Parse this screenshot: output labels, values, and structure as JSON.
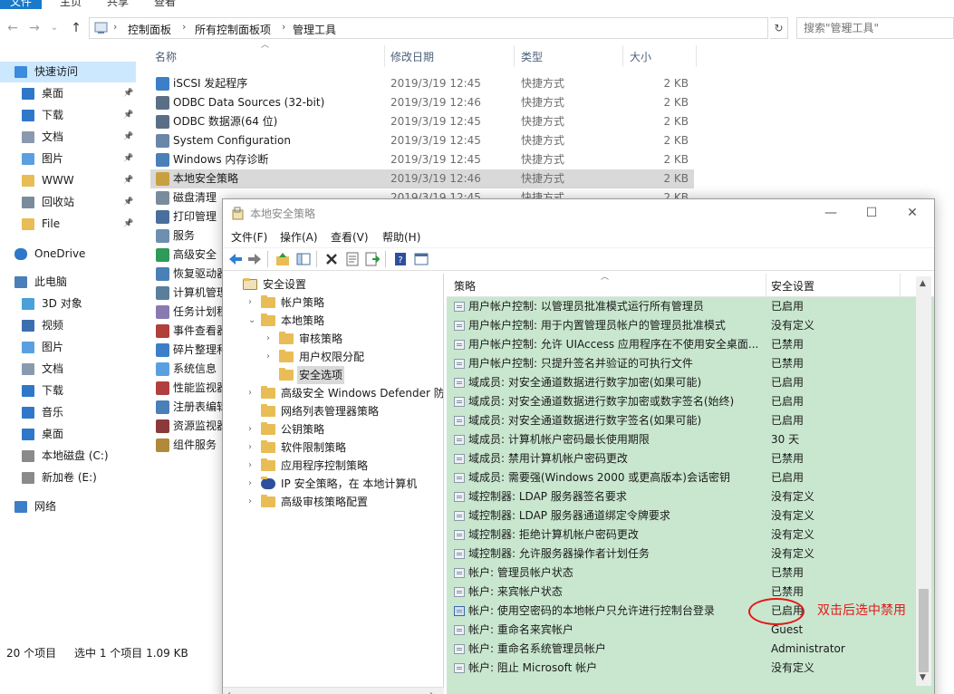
{
  "explorer": {
    "ribbon_tabs": [
      "文件",
      "主页",
      "共享",
      "查看"
    ],
    "breadcrumb": [
      "控制面板",
      "所有控制面板项",
      "管理工具"
    ],
    "search_placeholder": "搜索\"管理工具\"",
    "columns": {
      "name": "名称",
      "date": "修改日期",
      "type": "类型",
      "size": "大小"
    },
    "nav": [
      {
        "label": "快速访问",
        "icon": "star-icon",
        "pinned": false
      },
      {
        "label": "桌面",
        "icon": "desktop-icon",
        "pinned": true
      },
      {
        "label": "下载",
        "icon": "download-icon",
        "pinned": true
      },
      {
        "label": "文档",
        "icon": "document-icon",
        "pinned": true
      },
      {
        "label": "图片",
        "icon": "pictures-icon",
        "pinned": true
      },
      {
        "label": "WWW",
        "icon": "folder-icon",
        "pinned": true
      },
      {
        "label": "回收站",
        "icon": "recycle-bin-icon",
        "pinned": true
      },
      {
        "label": "File",
        "icon": "folder-icon",
        "pinned": true
      },
      {
        "label": "OneDrive",
        "icon": "cloud-icon",
        "pinned": false
      },
      {
        "label": "此电脑",
        "icon": "computer-icon",
        "pinned": false
      },
      {
        "label": "3D 对象",
        "icon": "3d-objects-icon",
        "pinned": false
      },
      {
        "label": "视频",
        "icon": "video-icon",
        "pinned": false
      },
      {
        "label": "图片",
        "icon": "pictures-icon",
        "pinned": false
      },
      {
        "label": "文档",
        "icon": "document-icon",
        "pinned": false
      },
      {
        "label": "下载",
        "icon": "download-icon",
        "pinned": false
      },
      {
        "label": "音乐",
        "icon": "music-icon",
        "pinned": false
      },
      {
        "label": "桌面",
        "icon": "desktop-icon",
        "pinned": false
      },
      {
        "label": "本地磁盘 (C:)",
        "icon": "drive-icon",
        "pinned": false
      },
      {
        "label": "新加卷 (E:)",
        "icon": "drive-icon",
        "pinned": false
      },
      {
        "label": "网络",
        "icon": "network-icon",
        "pinned": false
      }
    ],
    "files": [
      {
        "name": "iSCSI 发起程序",
        "date": "2019/3/19 12:45",
        "type": "快捷方式",
        "size": "2 KB"
      },
      {
        "name": "ODBC Data Sources (32-bit)",
        "date": "2019/3/19 12:46",
        "type": "快捷方式",
        "size": "2 KB"
      },
      {
        "name": "ODBC 数据源(64 位)",
        "date": "2019/3/19 12:45",
        "type": "快捷方式",
        "size": "2 KB"
      },
      {
        "name": "System Configuration",
        "date": "2019/3/19 12:45",
        "type": "快捷方式",
        "size": "2 KB"
      },
      {
        "name": "Windows 内存诊断",
        "date": "2019/3/19 12:45",
        "type": "快捷方式",
        "size": "2 KB"
      },
      {
        "name": "本地安全策略",
        "date": "2019/3/19 12:46",
        "type": "快捷方式",
        "size": "2 KB"
      },
      {
        "name": "磁盘清理",
        "date": "2019/3/19 12:45",
        "type": "快捷方式",
        "size": "2 KB"
      },
      {
        "name": "打印管理",
        "date": "",
        "type": "",
        "size": ""
      },
      {
        "name": "服务",
        "date": "",
        "type": "",
        "size": ""
      },
      {
        "name": "高级安全",
        "date": "",
        "type": "",
        "size": ""
      },
      {
        "name": "恢复驱动器",
        "date": "",
        "type": "",
        "size": ""
      },
      {
        "name": "计算机管理",
        "date": "",
        "type": "",
        "size": ""
      },
      {
        "name": "任务计划程序",
        "date": "",
        "type": "",
        "size": ""
      },
      {
        "name": "事件查看器",
        "date": "",
        "type": "",
        "size": ""
      },
      {
        "name": "碎片整理和",
        "date": "",
        "type": "",
        "size": ""
      },
      {
        "name": "系统信息",
        "date": "",
        "type": "",
        "size": ""
      },
      {
        "name": "性能监视器",
        "date": "",
        "type": "",
        "size": ""
      },
      {
        "name": "注册表编辑器",
        "date": "",
        "type": "",
        "size": ""
      },
      {
        "name": "资源监视器",
        "date": "",
        "type": "",
        "size": ""
      },
      {
        "name": "组件服务",
        "date": "",
        "type": "",
        "size": ""
      }
    ],
    "status": {
      "count": "20 个项目",
      "selected": "选中 1 个项目  1.09 KB"
    }
  },
  "lsp": {
    "title": "本地安全策略",
    "menu": [
      "文件(F)",
      "操作(A)",
      "查看(V)",
      "帮助(H)"
    ],
    "tree": [
      {
        "label": "安全设置",
        "level": 0,
        "expand": ""
      },
      {
        "label": "帐户策略",
        "level": 1,
        "expand": "›"
      },
      {
        "label": "本地策略",
        "level": 1,
        "expand": "⌄"
      },
      {
        "label": "审核策略",
        "level": 2,
        "expand": "›"
      },
      {
        "label": "用户权限分配",
        "level": 2,
        "expand": "›"
      },
      {
        "label": "安全选项",
        "level": 2,
        "expand": ""
      },
      {
        "label": "高级安全 Windows Defender 防火墙",
        "level": 1,
        "expand": "›"
      },
      {
        "label": "网络列表管理器策略",
        "level": 1,
        "expand": ""
      },
      {
        "label": "公钥策略",
        "level": 1,
        "expand": "›"
      },
      {
        "label": "软件限制策略",
        "level": 1,
        "expand": "›"
      },
      {
        "label": "应用程序控制策略",
        "level": 1,
        "expand": "›"
      },
      {
        "label": "IP 安全策略，在 本地计算机",
        "level": 1,
        "expand": "›"
      },
      {
        "label": "高级审核策略配置",
        "level": 1,
        "expand": "›"
      }
    ],
    "columns": {
      "policy": "策略",
      "setting": "安全设置"
    },
    "policies": [
      {
        "name": "用户帐户控制: 以管理员批准模式运行所有管理员",
        "value": "已启用"
      },
      {
        "name": "用户帐户控制: 用于内置管理员帐户的管理员批准模式",
        "value": "没有定义"
      },
      {
        "name": "用户帐户控制: 允许 UIAccess 应用程序在不使用安全桌面...",
        "value": "已禁用"
      },
      {
        "name": "用户帐户控制: 只提升签名并验证的可执行文件",
        "value": "已禁用"
      },
      {
        "name": "域成员: 对安全通道数据进行数字加密(如果可能)",
        "value": "已启用"
      },
      {
        "name": "域成员: 对安全通道数据进行数字加密或数字签名(始终)",
        "value": "已启用"
      },
      {
        "name": "域成员: 对安全通道数据进行数字签名(如果可能)",
        "value": "已启用"
      },
      {
        "name": "域成员: 计算机帐户密码最长使用期限",
        "value": "30 天"
      },
      {
        "name": "域成员: 禁用计算机帐户密码更改",
        "value": "已禁用"
      },
      {
        "name": "域成员: 需要强(Windows 2000 或更高版本)会话密钥",
        "value": "已启用"
      },
      {
        "name": "域控制器: LDAP 服务器签名要求",
        "value": "没有定义"
      },
      {
        "name": "域控制器: LDAP 服务器通道绑定令牌要求",
        "value": "没有定义"
      },
      {
        "name": "域控制器: 拒绝计算机帐户密码更改",
        "value": "没有定义"
      },
      {
        "name": "域控制器: 允许服务器操作者计划任务",
        "value": "没有定义"
      },
      {
        "name": "帐户: 管理员帐户状态",
        "value": "已禁用"
      },
      {
        "name": "帐户: 来宾帐户状态",
        "value": "已禁用"
      },
      {
        "name": "帐户: 使用空密码的本地帐户只允许进行控制台登录",
        "value": "已启用"
      },
      {
        "name": "帐户: 重命名来宾帐户",
        "value": "Guest"
      },
      {
        "name": "帐户: 重命名系统管理员帐户",
        "value": "Administrator"
      },
      {
        "name": "帐户: 阻止 Microsoft 帐户",
        "value": "没有定义"
      }
    ]
  },
  "annotation": {
    "note": "双击后选中禁用",
    "color": "#e01818"
  },
  "colors": {
    "list_bg": "#c9e7cf",
    "accent": "#1979ca",
    "selection": "#cce8ff"
  }
}
